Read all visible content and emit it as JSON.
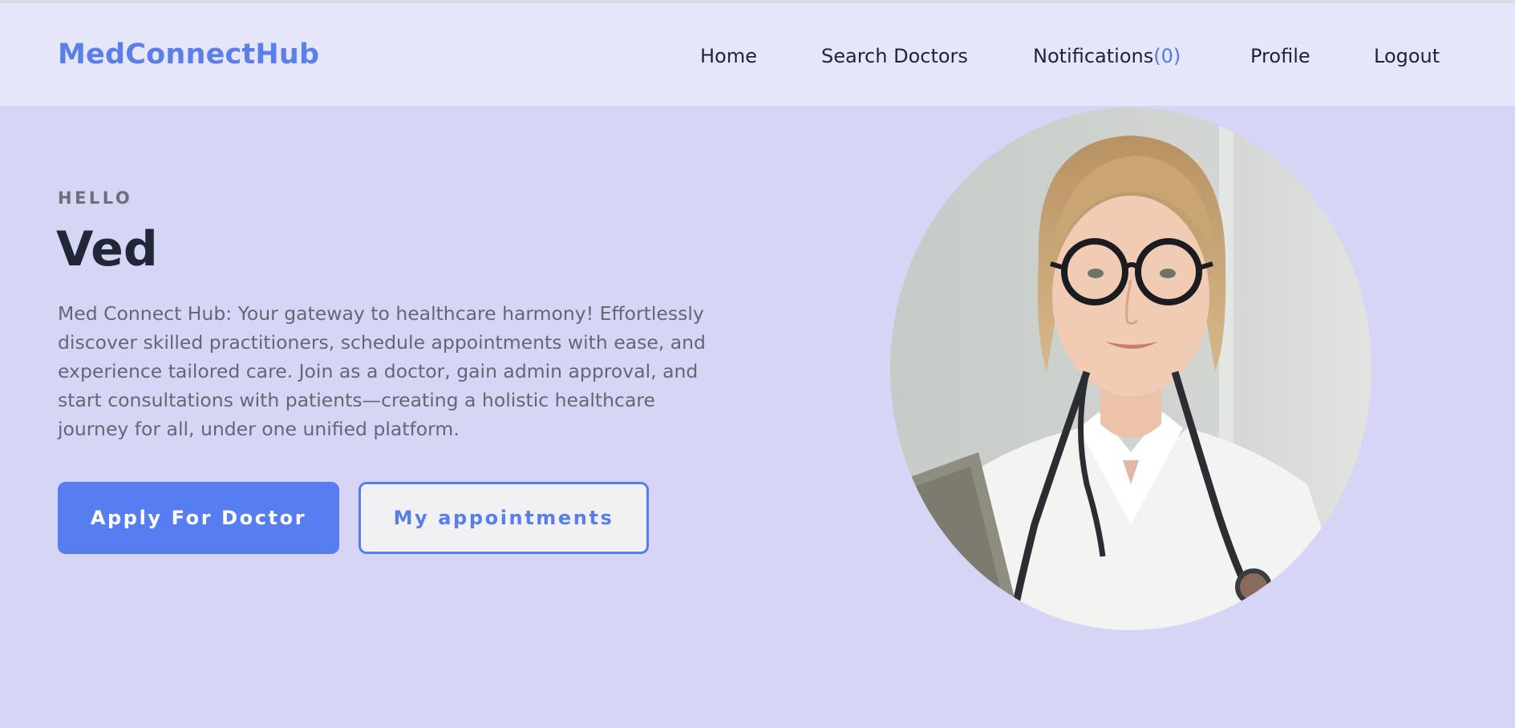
{
  "navbar": {
    "brand": "MedConnectHub",
    "links": {
      "home": "Home",
      "search_doctors": "Search Doctors",
      "notifications": "Notifications",
      "notifications_count": "(0)",
      "profile": "Profile",
      "logout": "Logout"
    }
  },
  "hero": {
    "greeting": "HELLO",
    "user_name": "Ved",
    "description": "Med Connect Hub: Your gateway to healthcare harmony! Effortlessly discover skilled practitioners, schedule appointments with ease, and experience tailored care. Join as a doctor, gain admin approval, and start consultations with patients—creating a holistic healthcare journey for all, under one unified platform.",
    "primary_button": "Apply For Doctor",
    "secondary_button": "My appointments",
    "image_alt": "Portrait of a smiling female doctor with glasses and stethoscope"
  },
  "colors": {
    "accent": "#577ef0",
    "navbar_bg": "#e6e6fa",
    "hero_bg": "#d6d5f6",
    "heading": "#202737"
  }
}
